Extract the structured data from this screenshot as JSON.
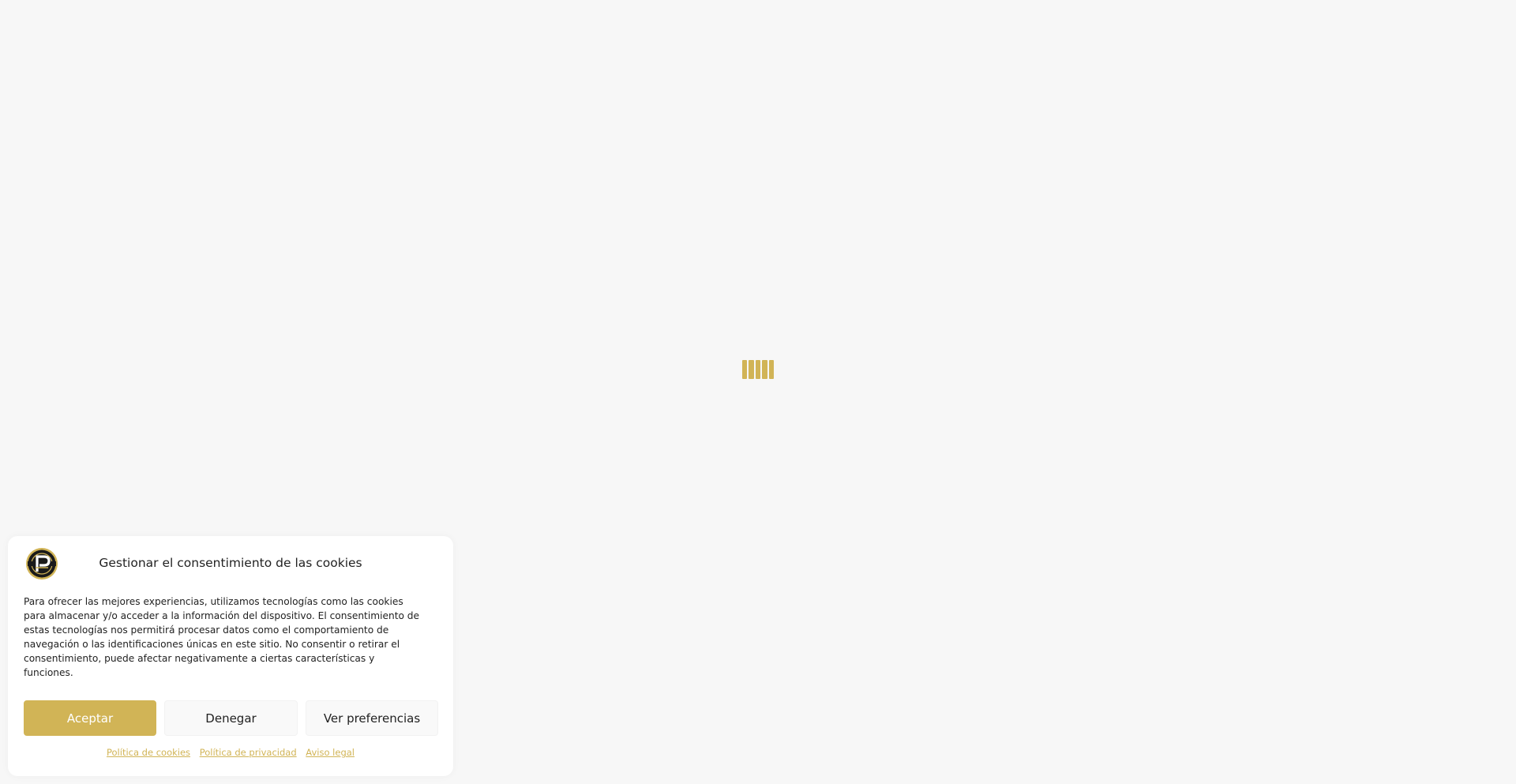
{
  "loader": {
    "icon": "loading-bars-icon",
    "color": "#d1b456"
  },
  "cookie_banner": {
    "logo_icon": "brand-logo-icon",
    "title": "Gestionar el consentimiento de las cookies",
    "message": "Para ofrecer las mejores experiencias, utilizamos tecnologías como las cookies para almacenar y/o acceder a la información del dispositivo. El consentimiento de estas tecnologías nos permitirá procesar datos como el comportamiento de navegación o las identificaciones únicas en este sitio. No consentir o retirar el consentimiento, puede afectar negativamente a ciertas características y funciones.",
    "buttons": {
      "accept_label": "Aceptar",
      "deny_label": "Denegar",
      "preferences_label": "Ver preferencias"
    },
    "links": {
      "cookie_policy": "Política de cookies",
      "privacy_policy": "Política de privacidad",
      "legal_notice": "Aviso legal"
    },
    "colors": {
      "accent": "#d1b456",
      "background": "#ffffff",
      "page_background": "#f7f7f7",
      "text": "#222222"
    }
  }
}
